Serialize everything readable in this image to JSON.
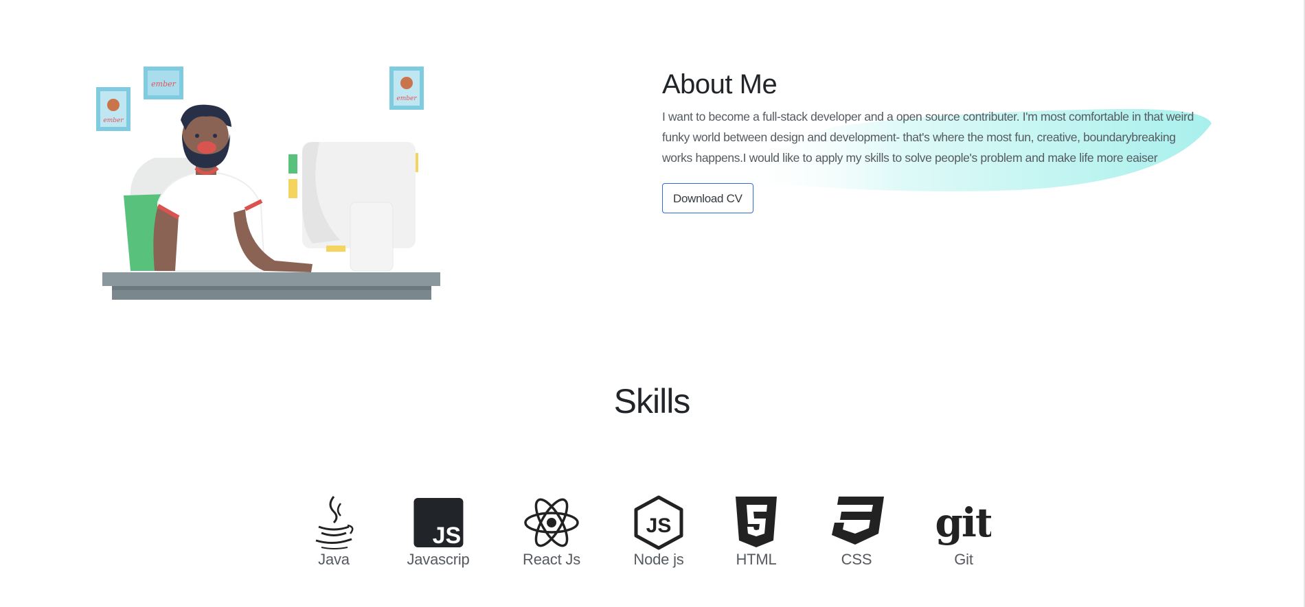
{
  "about": {
    "title": "About Me",
    "text": "I want to become a full-stack developer and a open source contributer. I'm most comfortable in that weird funky world between design and development- that's where the most fun, creative, boundarybreaking works happens.I would like to apply my skills to solve people's problem and make life more eaiser",
    "download_label": "Download CV",
    "frame_labels": [
      "ember",
      "ember",
      "ember"
    ]
  },
  "skills": {
    "title": "Skills",
    "items": [
      {
        "label": "Java",
        "icon": "java-icon"
      },
      {
        "label": "Javascrip",
        "icon": "javascript-icon"
      },
      {
        "label": "React Js",
        "icon": "react-icon"
      },
      {
        "label": "Node js",
        "icon": "nodejs-icon"
      },
      {
        "label": "HTML",
        "icon": "html5-icon"
      },
      {
        "label": "CSS",
        "icon": "css3-icon"
      },
      {
        "label": "Git",
        "icon": "git-icon"
      }
    ]
  },
  "colors": {
    "accent": "#2d6adf",
    "highlight": "#a8f0ec",
    "text": "#555a60"
  }
}
